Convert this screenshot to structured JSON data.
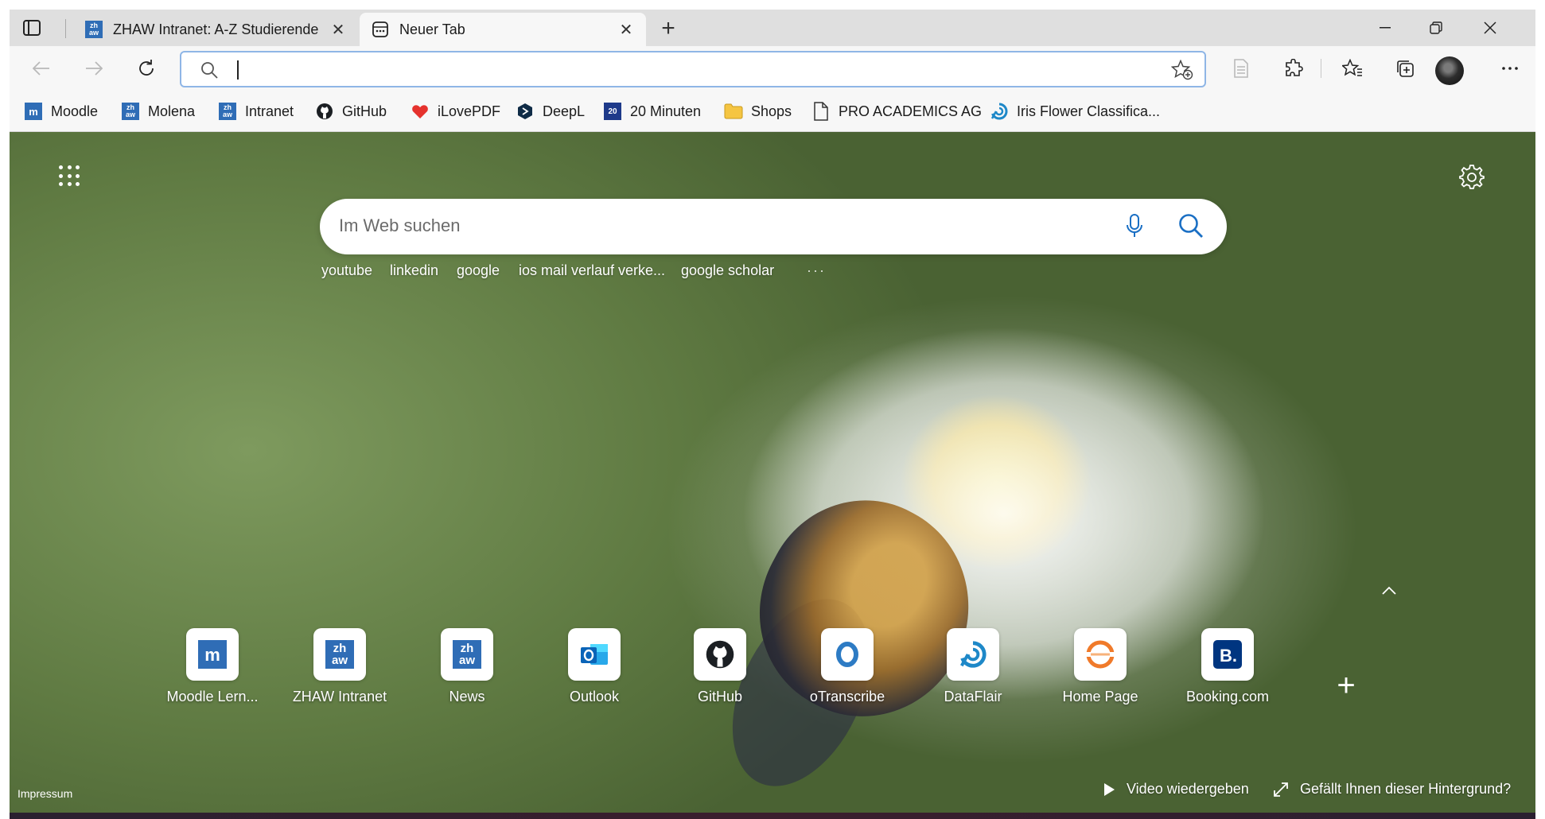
{
  "tabs": [
    {
      "title": "ZHAW Intranet: A-Z Studierende",
      "active": false,
      "favicon": "zhaw-icon"
    },
    {
      "title": "Neuer Tab",
      "active": true,
      "favicon": "newtab-icon"
    }
  ],
  "toolbar": {
    "address_value": "",
    "icons": [
      "back-icon",
      "forward-icon",
      "reload-icon",
      "search-icon",
      "add-favorite-icon",
      "reading-view-icon",
      "extensions-icon",
      "favorites-icon",
      "collections-icon",
      "profile-avatar",
      "more-icon"
    ]
  },
  "bookmarks": [
    {
      "label": "Moodle",
      "icon": "moodle-icon"
    },
    {
      "label": "Molena",
      "icon": "zhaw-icon"
    },
    {
      "label": "Intranet",
      "icon": "zhaw-icon"
    },
    {
      "label": "GitHub",
      "icon": "github-icon"
    },
    {
      "label": "iLovePDF",
      "icon": "heart-icon"
    },
    {
      "label": "DeepL",
      "icon": "deepl-icon"
    },
    {
      "label": "20 Minuten",
      "icon": "20min-icon"
    },
    {
      "label": "Shops",
      "icon": "folder-icon"
    },
    {
      "label": "PRO ACADEMICS AG",
      "icon": "page-icon"
    },
    {
      "label": "Iris Flower Classifica...",
      "icon": "dataflair-icon"
    }
  ],
  "search": {
    "placeholder": "Im Web suchen",
    "suggestions": [
      "youtube",
      "linkedin",
      "google",
      "ios mail verlauf verke...",
      "google scholar"
    ],
    "more": "···"
  },
  "quick_links": [
    {
      "label": "Moodle Lern...",
      "icon": "moodle-icon"
    },
    {
      "label": "ZHAW Intranet",
      "icon": "zhaw-icon"
    },
    {
      "label": "News",
      "icon": "zhaw-icon"
    },
    {
      "label": "Outlook",
      "icon": "outlook-icon"
    },
    {
      "label": "GitHub",
      "icon": "github-icon"
    },
    {
      "label": "oTranscribe",
      "icon": "otranscribe-icon"
    },
    {
      "label": "DataFlair",
      "icon": "dataflair-icon"
    },
    {
      "label": "Home Page",
      "icon": "homepage-icon"
    },
    {
      "label": "Booking.com",
      "icon": "booking-icon"
    }
  ],
  "footer": {
    "impressum": "Impressum",
    "video": "Video wiedergeben",
    "like_background": "Gefällt Ihnen dieser Hintergrund?"
  },
  "colors": {
    "accent": "#2f6db6",
    "address_border": "#8fb6e6",
    "background_green": "#5f7a42"
  }
}
